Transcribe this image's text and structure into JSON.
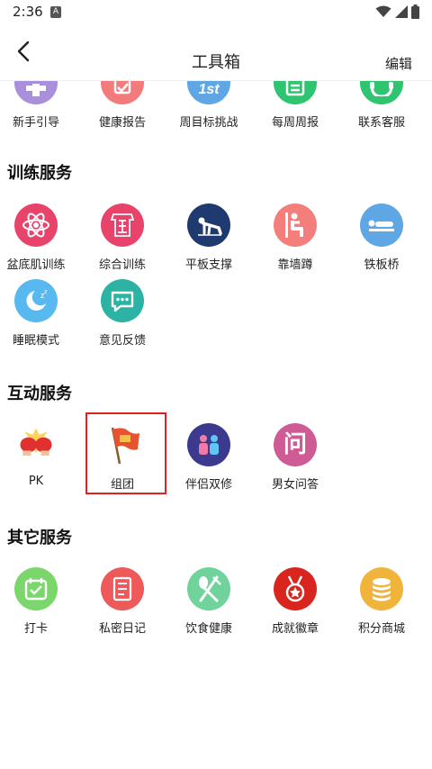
{
  "status": {
    "time": "2:36"
  },
  "header": {
    "title": "工具箱",
    "edit_label": "编辑"
  },
  "top_row": [
    {
      "label": "新手引导",
      "color": "#a98fdc",
      "icon": "plus-icon"
    },
    {
      "label": "健康报告",
      "color": "#f47b7b",
      "icon": "report-icon"
    },
    {
      "label": "周目标挑战",
      "color": "#5fa6e4",
      "icon": "target-icon"
    },
    {
      "label": "每周周报",
      "color": "#2fc46f",
      "icon": "list-icon"
    },
    {
      "label": "联系客服",
      "color": "#2fc46f",
      "icon": "headset-icon"
    }
  ],
  "sections": [
    {
      "title": "训练服务",
      "items": [
        {
          "label": "盆底肌训练",
          "color": "#e8436b",
          "icon": "atom-icon"
        },
        {
          "label": "综合训练",
          "color": "#e8436b",
          "icon": "training-icon"
        },
        {
          "label": "平板支撑",
          "color": "#1f3a6e",
          "icon": "plank-icon"
        },
        {
          "label": "靠墙蹲",
          "color": "#f37e7b",
          "icon": "wall-squat-icon"
        },
        {
          "label": "铁板桥",
          "color": "#5fa6e4",
          "icon": "bridge-icon"
        },
        {
          "label": "睡眠模式",
          "color": "#58b8f0",
          "icon": "moon-icon"
        },
        {
          "label": "意见反馈",
          "color": "#2cb3a4",
          "icon": "chat-icon"
        }
      ]
    },
    {
      "title": "互动服务",
      "items": [
        {
          "label": "PK",
          "color": "#ffffff",
          "icon": "boxing-gloves-icon"
        },
        {
          "label": "组团",
          "color": "#ffffff",
          "icon": "flag-icon"
        },
        {
          "label": "伴侣双修",
          "color": "#3c3a8f",
          "icon": "couple-icon"
        },
        {
          "label": "男女问答",
          "color": "#cf5b94",
          "icon": "question-icon",
          "glyph": "问"
        }
      ]
    },
    {
      "title": "其它服务",
      "items": [
        {
          "label": "打卡",
          "color": "#7bd66b",
          "icon": "calendar-check-icon"
        },
        {
          "label": "私密日记",
          "color": "#ee5a5a",
          "icon": "diary-icon"
        },
        {
          "label": "饮食健康",
          "color": "#6fd39b",
          "icon": "utensils-icon"
        },
        {
          "label": "成就徽章",
          "color": "#d8261f",
          "icon": "medal-icon"
        },
        {
          "label": "积分商城",
          "color": "#f1b43a",
          "icon": "coins-icon"
        }
      ]
    }
  ]
}
